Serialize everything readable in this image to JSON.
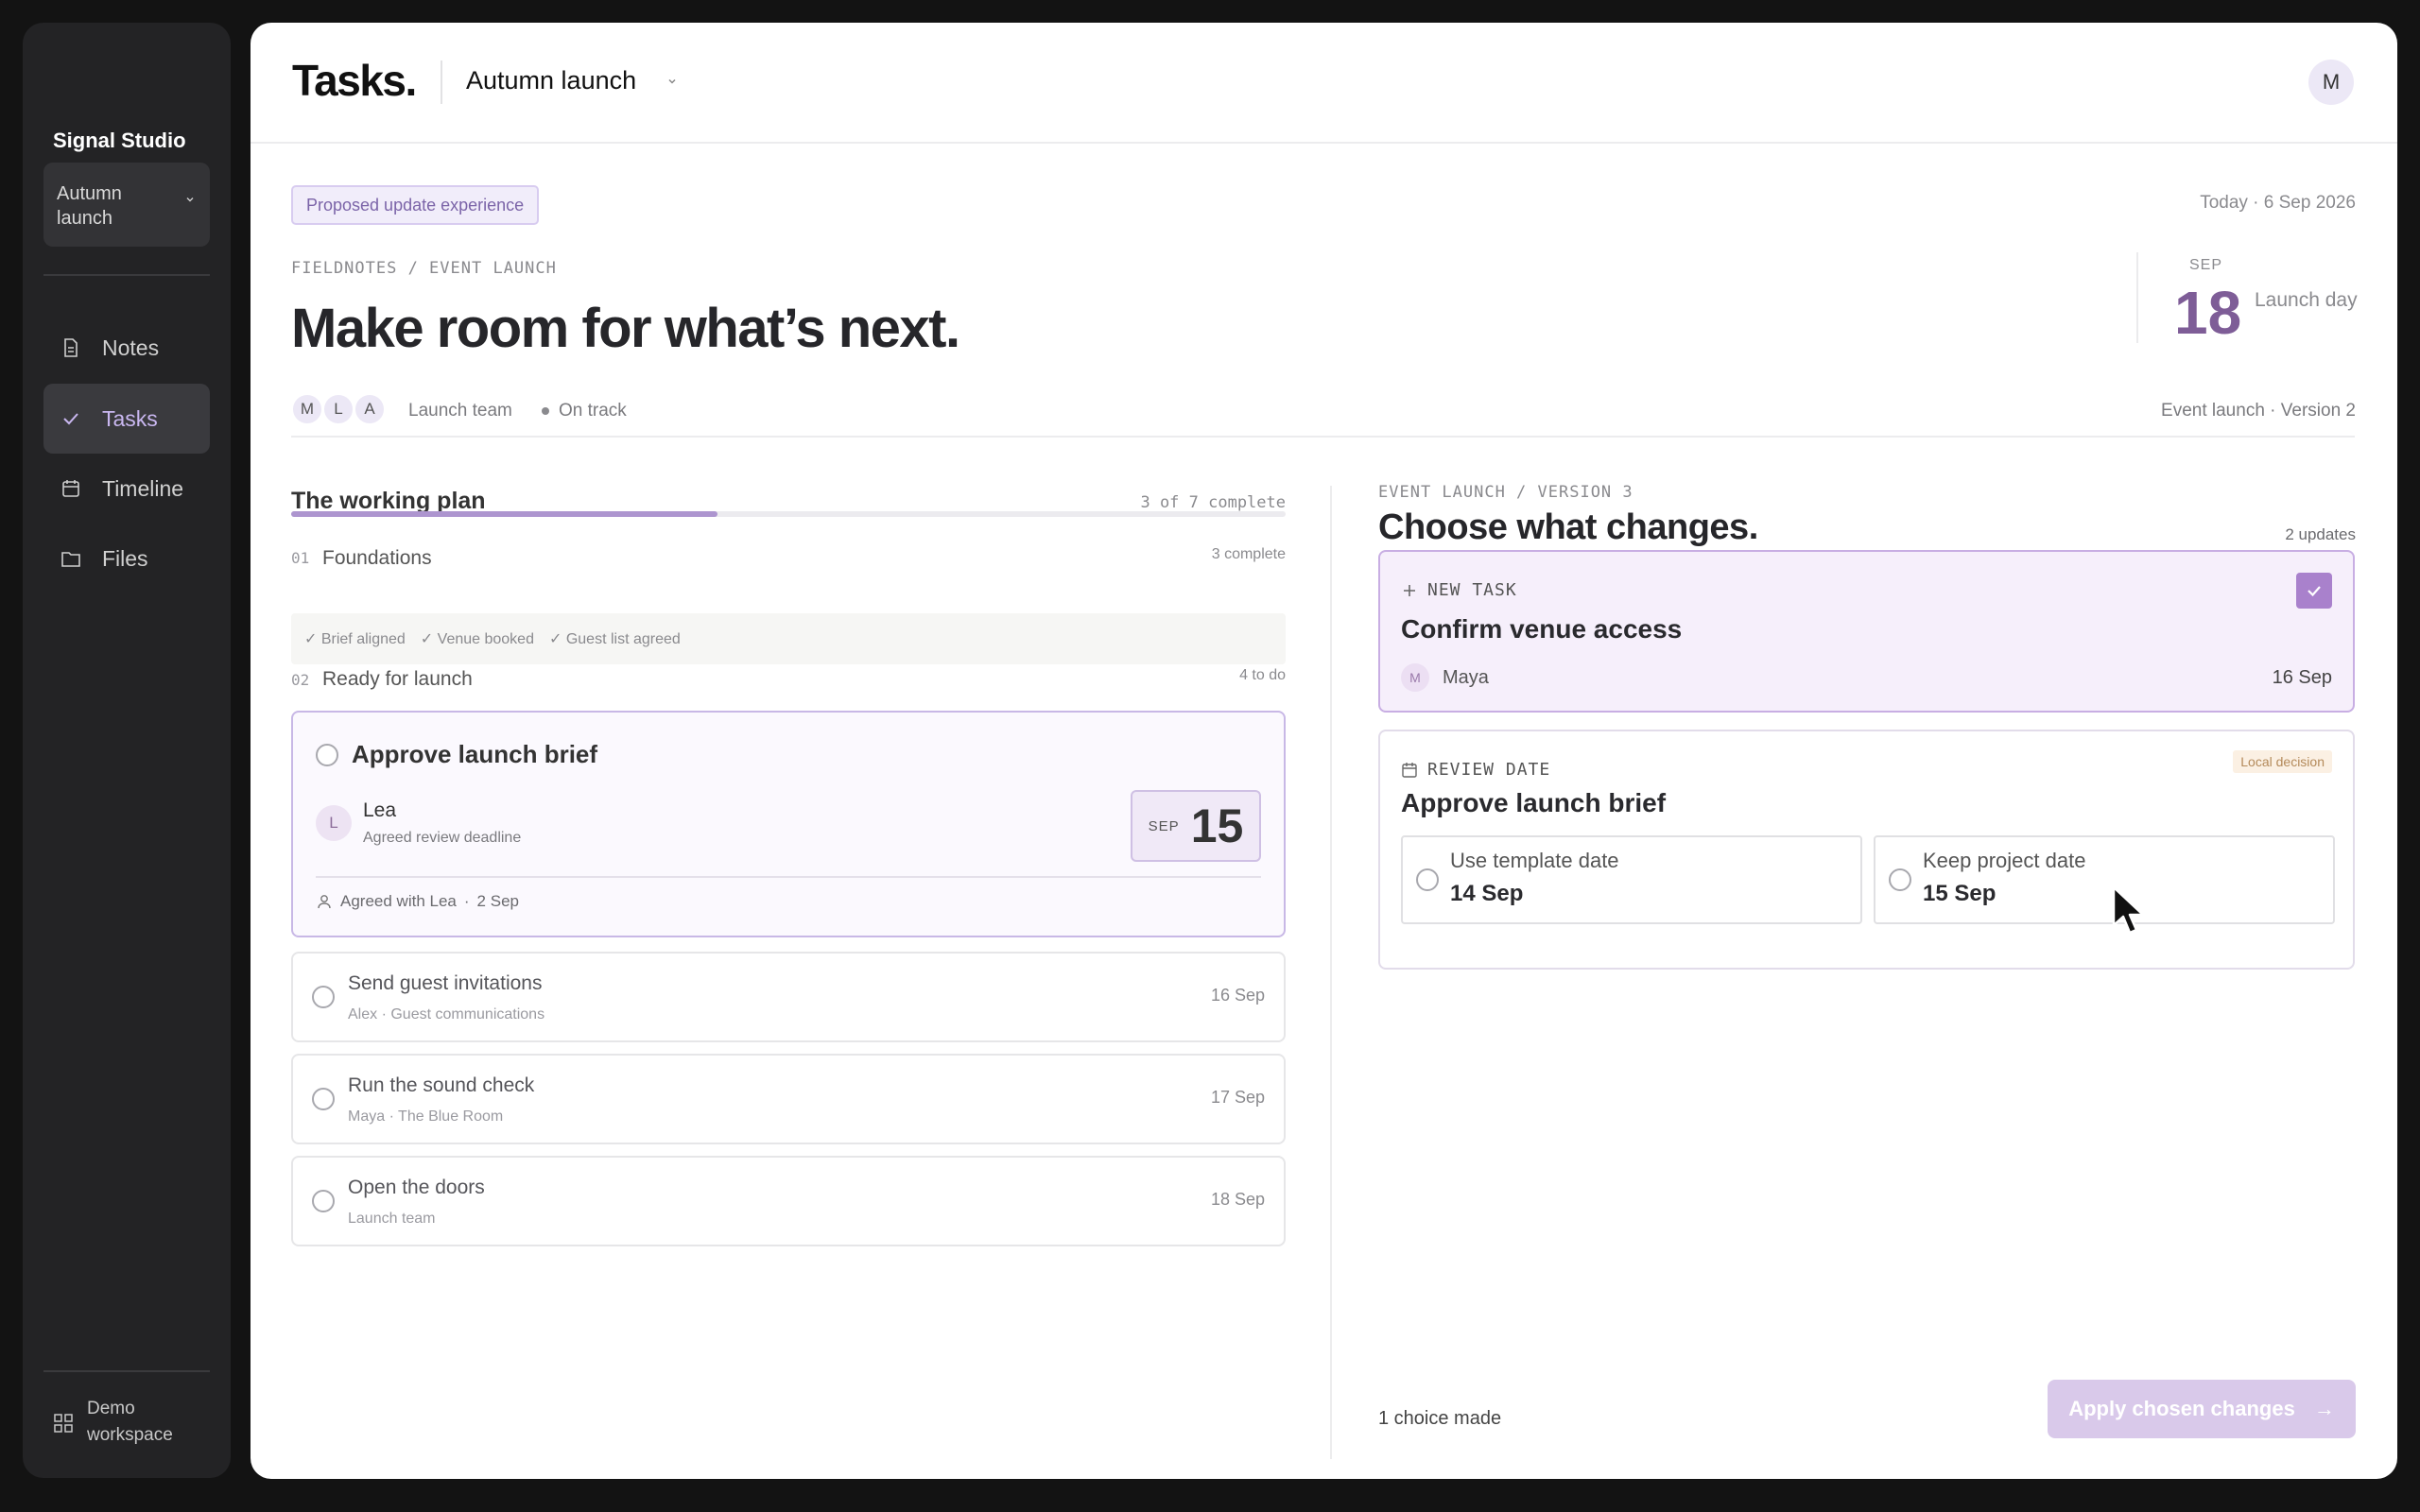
{
  "sidebar": {
    "brand": "Signal Studio",
    "project_select": "Autumn launch",
    "items": [
      {
        "label": "Notes",
        "icon": "document-icon"
      },
      {
        "label": "Tasks",
        "icon": "check-icon",
        "active": true
      },
      {
        "label": "Timeline",
        "icon": "calendar-icon"
      },
      {
        "label": "Files",
        "icon": "folder-icon"
      }
    ],
    "workspace": "Demo workspace"
  },
  "topbar": {
    "title": "Tasks.",
    "project": "Autumn launch",
    "avatar": "M"
  },
  "header": {
    "badge": "Proposed update experience",
    "today": "Today · 6 Sep 2026",
    "crumb": "FIELDNOTES / EVENT LAUNCH",
    "title": "Make room for what’s next.",
    "avatars": [
      "M",
      "L",
      "A"
    ],
    "team": "Launch team",
    "status": "On track",
    "date_month": "SEP",
    "date_day": "18",
    "date_label": "Launch day",
    "version_meta": "Event launch · Version 2"
  },
  "plan": {
    "title": "The working plan",
    "count": "3 of 7 complete",
    "progress_fraction": 0.4286,
    "sections": [
      {
        "num": "01",
        "title": "Foundations",
        "count": "3 complete",
        "done": [
          "✓ Brief aligned",
          "✓ Venue booked",
          "✓ Guest list agreed"
        ]
      },
      {
        "num": "02",
        "title": "Ready for launch",
        "count": "4 to do"
      }
    ],
    "featured_task": {
      "title": "Approve launch brief",
      "assignee_initial": "L",
      "assignee": "Lea",
      "assignee_note": "Agreed review deadline",
      "chip_month": "SEP",
      "chip_day": "15",
      "agreed_with": "Agreed with Lea",
      "agreed_date": "2 Sep"
    },
    "tasks": [
      {
        "title": "Send guest invitations",
        "sub": "Alex · Guest communications",
        "date": "16 Sep"
      },
      {
        "title": "Run the sound check",
        "sub": "Maya · The Blue Room",
        "date": "17 Sep"
      },
      {
        "title": "Open the doors",
        "sub": "Launch team",
        "date": "18 Sep"
      }
    ]
  },
  "changes": {
    "crumb": "EVENT LAUNCH / VERSION 3",
    "title": "Choose what changes.",
    "count": "2 updates",
    "new_task": {
      "kicker": "NEW TASK",
      "title": "Confirm venue access",
      "assignee_initial": "M",
      "assignee": "Maya",
      "date": "16 Sep"
    },
    "review": {
      "kicker": "REVIEW DATE",
      "badge": "Local decision",
      "title": "Approve launch brief",
      "options": [
        {
          "label": "Use template date",
          "value": "14 Sep"
        },
        {
          "label": "Keep project date",
          "value": "15 Sep"
        }
      ]
    },
    "choice_made": "1 choice made",
    "apply": "Apply chosen changes",
    "apply_arrow": "→"
  },
  "colors": {
    "accent": "#a981cc",
    "sidebar_bg": "#232325",
    "date_accent": "#7e5d97"
  }
}
